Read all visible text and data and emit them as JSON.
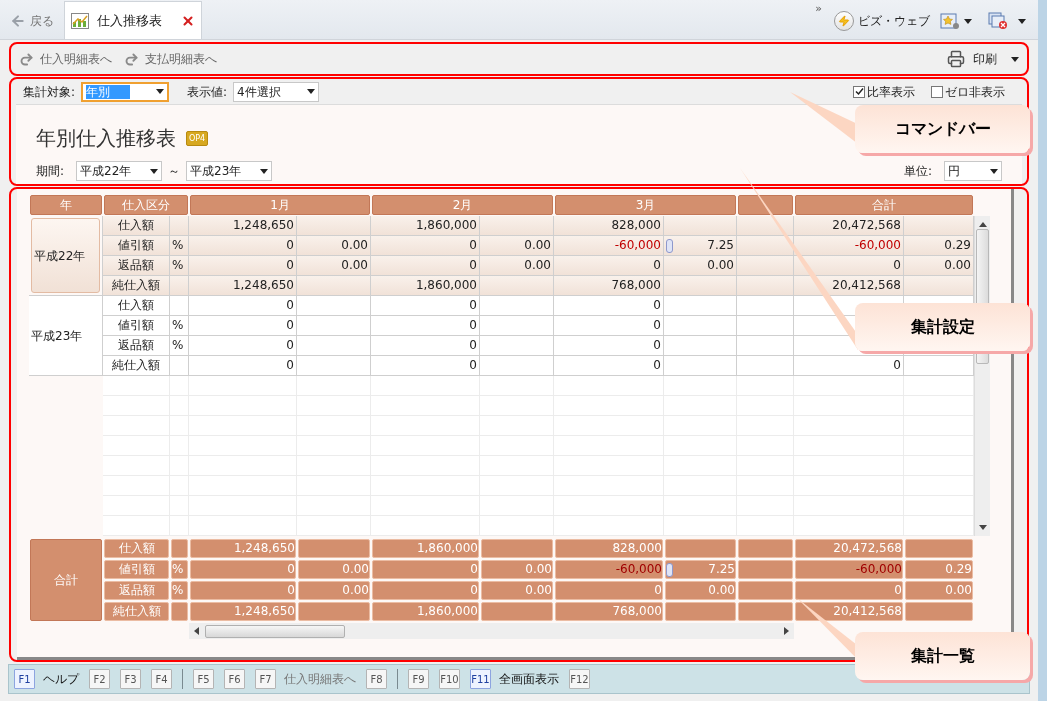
{
  "tabbar": {
    "back": "戻る",
    "tab": {
      "title": "仕入推移表"
    },
    "overflow": "»",
    "bizweb": "ビズ・ウェブ"
  },
  "command_bar": {
    "links": [
      "仕入明細表へ",
      "支払明細表へ"
    ],
    "print": "印刷"
  },
  "settings": {
    "target_label": "集計対象:",
    "target_value": "年別",
    "display_label": "表示値:",
    "display_value": "4件選択",
    "checkboxes": [
      {
        "label": "比率表示",
        "checked": true
      },
      {
        "label": "ゼロ非表示",
        "checked": false
      }
    ]
  },
  "report": {
    "title": "年別仕入推移表",
    "badge": "OP4",
    "period_label": "期間:",
    "period_from": "平成22年",
    "tilde": "～",
    "period_to": "平成23年",
    "unit_label": "単位:",
    "unit_value": "円"
  },
  "table": {
    "columns": [
      "年",
      "仕入区分",
      "1月",
      "2月",
      "3月",
      "合計"
    ],
    "groups": [
      {
        "year": "平成22年",
        "selected": true,
        "rows": [
          {
            "label": "仕入額",
            "months": [
              {
                "amount": "1,248,650"
              },
              {
                "amount": "1,860,000"
              },
              {
                "amount": "828,000"
              }
            ],
            "total": {
              "amount": "20,472,568"
            }
          },
          {
            "label": "値引額",
            "unit": "%",
            "months": [
              {
                "amount": "0",
                "ratio": "0.00"
              },
              {
                "amount": "0",
                "ratio": "0.00"
              },
              {
                "amount": "-60,000",
                "negative": true,
                "ratio": "7.25",
                "marker": true
              }
            ],
            "total": {
              "amount": "-60,000",
              "negative": true,
              "ratio": "0.29"
            }
          },
          {
            "label": "返品額",
            "unit": "%",
            "months": [
              {
                "amount": "0",
                "ratio": "0.00"
              },
              {
                "amount": "0",
                "ratio": "0.00"
              },
              {
                "amount": "0",
                "ratio": "0.00"
              }
            ],
            "total": {
              "amount": "0",
              "ratio": "0.00"
            }
          },
          {
            "label": "純仕入額",
            "months": [
              {
                "amount": "1,248,650"
              },
              {
                "amount": "1,860,000"
              },
              {
                "amount": "768,000"
              }
            ],
            "total": {
              "amount": "20,412,568"
            }
          }
        ]
      },
      {
        "year": "平成23年",
        "selected": false,
        "rows": [
          {
            "label": "仕入額",
            "months": [
              {
                "amount": "0"
              },
              {
                "amount": "0"
              },
              {
                "amount": "0"
              }
            ]
          },
          {
            "label": "値引額",
            "unit": "%",
            "months": [
              {
                "amount": "0"
              },
              {
                "amount": "0"
              },
              {
                "amount": "0"
              }
            ]
          },
          {
            "label": "返品額",
            "unit": "%",
            "months": [
              {
                "amount": "0"
              },
              {
                "amount": "0"
              },
              {
                "amount": "0"
              }
            ]
          },
          {
            "label": "純仕入額",
            "months": [
              {
                "amount": "0"
              },
              {
                "amount": "0"
              },
              {
                "amount": "0"
              }
            ],
            "total": {
              "amount": "0"
            }
          }
        ]
      }
    ],
    "total": {
      "label": "合計",
      "rows": [
        {
          "label": "仕入額",
          "months": [
            {
              "amount": "1,248,650"
            },
            {
              "amount": "1,860,000"
            },
            {
              "amount": "828,000"
            }
          ],
          "total": {
            "amount": "20,472,568"
          }
        },
        {
          "label": "値引額",
          "unit": "%",
          "months": [
            {
              "amount": "0",
              "ratio": "0.00"
            },
            {
              "amount": "0",
              "ratio": "0.00"
            },
            {
              "amount": "-60,000",
              "negative": true,
              "ratio": "7.25",
              "marker": true
            }
          ],
          "total": {
            "amount": "-60,000",
            "negative": true,
            "ratio": "0.29"
          }
        },
        {
          "label": "返品額",
          "unit": "%",
          "months": [
            {
              "amount": "0",
              "ratio": "0.00"
            },
            {
              "amount": "0",
              "ratio": "0.00"
            },
            {
              "amount": "0",
              "ratio": "0.00"
            }
          ],
          "total": {
            "amount": "0",
            "ratio": "0.00"
          }
        },
        {
          "label": "純仕入額",
          "months": [
            {
              "amount": "1,248,650"
            },
            {
              "amount": "1,860,000"
            },
            {
              "amount": "768,000"
            }
          ],
          "total": {
            "amount": "20,412,568"
          }
        }
      ]
    }
  },
  "function_keys": [
    [
      {
        "key": "F1",
        "label": "ヘルプ",
        "enabled": true
      },
      {
        "key": "F2",
        "enabled": false
      },
      {
        "key": "F3",
        "enabled": false
      },
      {
        "key": "F4",
        "enabled": false
      }
    ],
    [
      {
        "key": "F5",
        "enabled": false
      },
      {
        "key": "F6",
        "enabled": false
      },
      {
        "key": "F7",
        "label": "仕入明細表へ",
        "enabled": false
      },
      {
        "key": "F8",
        "enabled": false
      }
    ],
    [
      {
        "key": "F9",
        "enabled": false
      },
      {
        "key": "F10",
        "enabled": false
      },
      {
        "key": "F11",
        "label": "全画面表示",
        "enabled": true
      },
      {
        "key": "F12",
        "enabled": false
      }
    ]
  ],
  "callouts": [
    {
      "text": "コマンドバー"
    },
    {
      "text": "集計設定"
    },
    {
      "text": "集計一覧"
    }
  ]
}
